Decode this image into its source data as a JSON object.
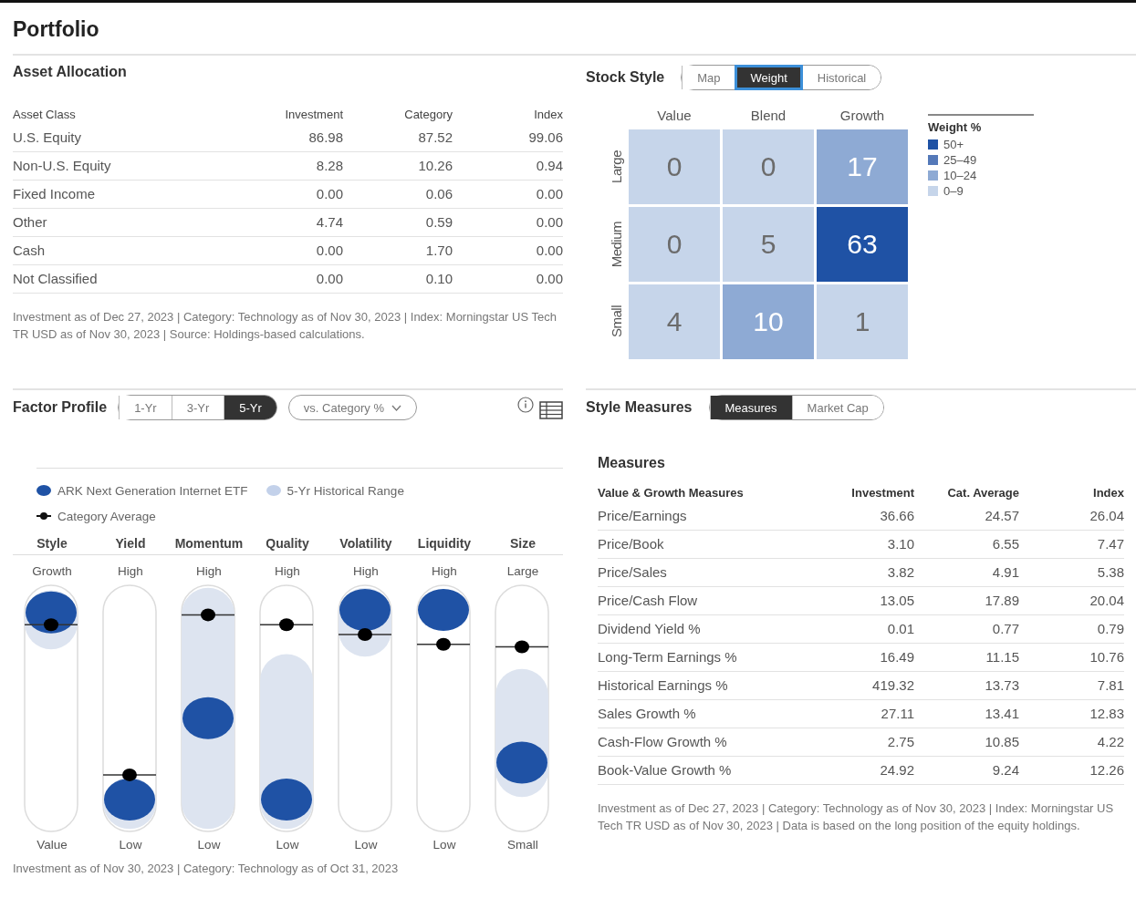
{
  "title": "Portfolio",
  "asset_allocation": {
    "title": "Asset Allocation",
    "columns": [
      "Asset Class",
      "Investment",
      "Category",
      "Index"
    ],
    "rows": [
      {
        "cells": [
          "U.S. Equity",
          "86.98",
          "87.52",
          "99.06"
        ]
      },
      {
        "cells": [
          "Non-U.S. Equity",
          "8.28",
          "10.26",
          "0.94"
        ]
      },
      {
        "cells": [
          "Fixed Income",
          "0.00",
          "0.06",
          "0.00"
        ]
      },
      {
        "cells": [
          "Other",
          "4.74",
          "0.59",
          "0.00"
        ]
      },
      {
        "cells": [
          "Cash",
          "0.00",
          "1.70",
          "0.00"
        ]
      },
      {
        "cells": [
          "Not Classified",
          "0.00",
          "0.10",
          "0.00"
        ]
      }
    ],
    "note": "Investment as of Dec 27, 2023 | Category: Technology as of Nov 30, 2023 | Index: Morningstar US Tech TR USD as of Nov 30, 2023 | Source: Holdings-based calculations."
  },
  "stock_style": {
    "title": "Stock Style",
    "views": [
      {
        "label": "Map",
        "selected": false,
        "focused": false
      },
      {
        "label": "Weight",
        "selected": true,
        "focused": true
      },
      {
        "label": "Historical",
        "selected": false,
        "focused": false
      }
    ],
    "columns": [
      "Value",
      "Blend",
      "Growth"
    ],
    "rows": [
      {
        "label": "Large",
        "cells": [
          {
            "value": "0",
            "kind": "low"
          },
          {
            "value": "0",
            "kind": "low"
          },
          {
            "value": "17",
            "kind": "mid"
          }
        ]
      },
      {
        "label": "Medium",
        "cells": [
          {
            "value": "0",
            "kind": "low"
          },
          {
            "value": "5",
            "kind": "low"
          },
          {
            "value": "63",
            "kind": "high"
          }
        ]
      },
      {
        "label": "Small",
        "cells": [
          {
            "value": "4",
            "kind": "low"
          },
          {
            "value": "10",
            "kind": "mid"
          },
          {
            "value": "1",
            "kind": "low"
          }
        ]
      }
    ],
    "legend": {
      "title": "Weight %",
      "items": [
        {
          "label": "50+",
          "color": "#1f52a5"
        },
        {
          "label": "25–49",
          "color": "#5479b9"
        },
        {
          "label": "10–24",
          "color": "#8eaad4"
        },
        {
          "label": "0–9",
          "color": "#c6d5ea"
        }
      ]
    }
  },
  "factor_profile": {
    "title": "Factor Profile",
    "periods": [
      {
        "label": "1-Yr",
        "selected": false
      },
      {
        "label": "3-Yr",
        "selected": false
      },
      {
        "label": "5-Yr",
        "selected": true
      }
    ],
    "compare": "vs. Category %",
    "legend": {
      "fund": "ARK Next Generation Internet ETF",
      "range": "5-Yr Historical Range",
      "category": "Category Average"
    },
    "factors": [
      {
        "name": "Style",
        "top": "Growth",
        "bottom": "Value",
        "fund": {
          "level": 0.89
        },
        "category_average": {
          "level": 0.84
        }
      },
      {
        "name": "Yield",
        "top": "High",
        "bottom": "Low",
        "fund": {
          "level": 0.13
        },
        "category_average": {
          "level": 0.23
        }
      },
      {
        "name": "Momentum",
        "top": "High",
        "bottom": "Low",
        "fund": {
          "level": 0.46
        },
        "category_average": {
          "level": 0.88
        }
      },
      {
        "name": "Quality",
        "top": "High",
        "bottom": "Low",
        "fund": {
          "level": 0.13
        },
        "category_average": {
          "level": 0.84
        }
      },
      {
        "name": "Volatility",
        "top": "High",
        "bottom": "Low",
        "fund": {
          "level": 0.9
        },
        "category_average": {
          "level": 0.8
        }
      },
      {
        "name": "Liquidity",
        "top": "High",
        "bottom": "Low",
        "fund": {
          "level": 0.9
        },
        "category_average": {
          "level": 0.76
        }
      },
      {
        "name": "Size",
        "top": "Large",
        "bottom": "Small",
        "fund": {
          "level": 0.28
        },
        "category_average": {
          "level": 0.75
        }
      }
    ],
    "note": "Investment as of Nov 30, 2023 | Category: Technology as of Oct 31, 2023"
  },
  "style_measures": {
    "title": "Style Measures",
    "views": [
      {
        "label": "Measures",
        "selected": true
      },
      {
        "label": "Market Cap",
        "selected": false
      }
    ],
    "subtitle": "Measures",
    "columns": [
      "Value & Growth Measures",
      "Investment",
      "Cat. Average",
      "Index"
    ],
    "rows": [
      {
        "cells": [
          "Price/Earnings",
          "36.66",
          "24.57",
          "26.04"
        ]
      },
      {
        "cells": [
          "Price/Book",
          "3.10",
          "6.55",
          "7.47"
        ]
      },
      {
        "cells": [
          "Price/Sales",
          "3.82",
          "4.91",
          "5.38"
        ]
      },
      {
        "cells": [
          "Price/Cash Flow",
          "13.05",
          "17.89",
          "20.04"
        ]
      },
      {
        "cells": [
          "Dividend Yield %",
          "0.01",
          "0.77",
          "0.79"
        ]
      },
      {
        "cells": [
          "Long-Term Earnings %",
          "16.49",
          "11.15",
          "10.76"
        ]
      },
      {
        "cells": [
          "Historical Earnings %",
          "419.32",
          "13.73",
          "7.81"
        ]
      },
      {
        "cells": [
          "Sales Growth %",
          "27.11",
          "13.41",
          "12.83"
        ]
      },
      {
        "cells": [
          "Cash-Flow Growth %",
          "2.75",
          "10.85",
          "4.22"
        ]
      },
      {
        "cells": [
          "Book-Value Growth %",
          "24.92",
          "9.24",
          "12.26"
        ]
      }
    ],
    "note": "Investment as of Dec 27, 2023 | Category: Technology as of Nov 30, 2023 | Index: Morningstar US Tech TR USD as of Nov 30, 2023 | Data is based on the long position of the equity holdings."
  }
}
